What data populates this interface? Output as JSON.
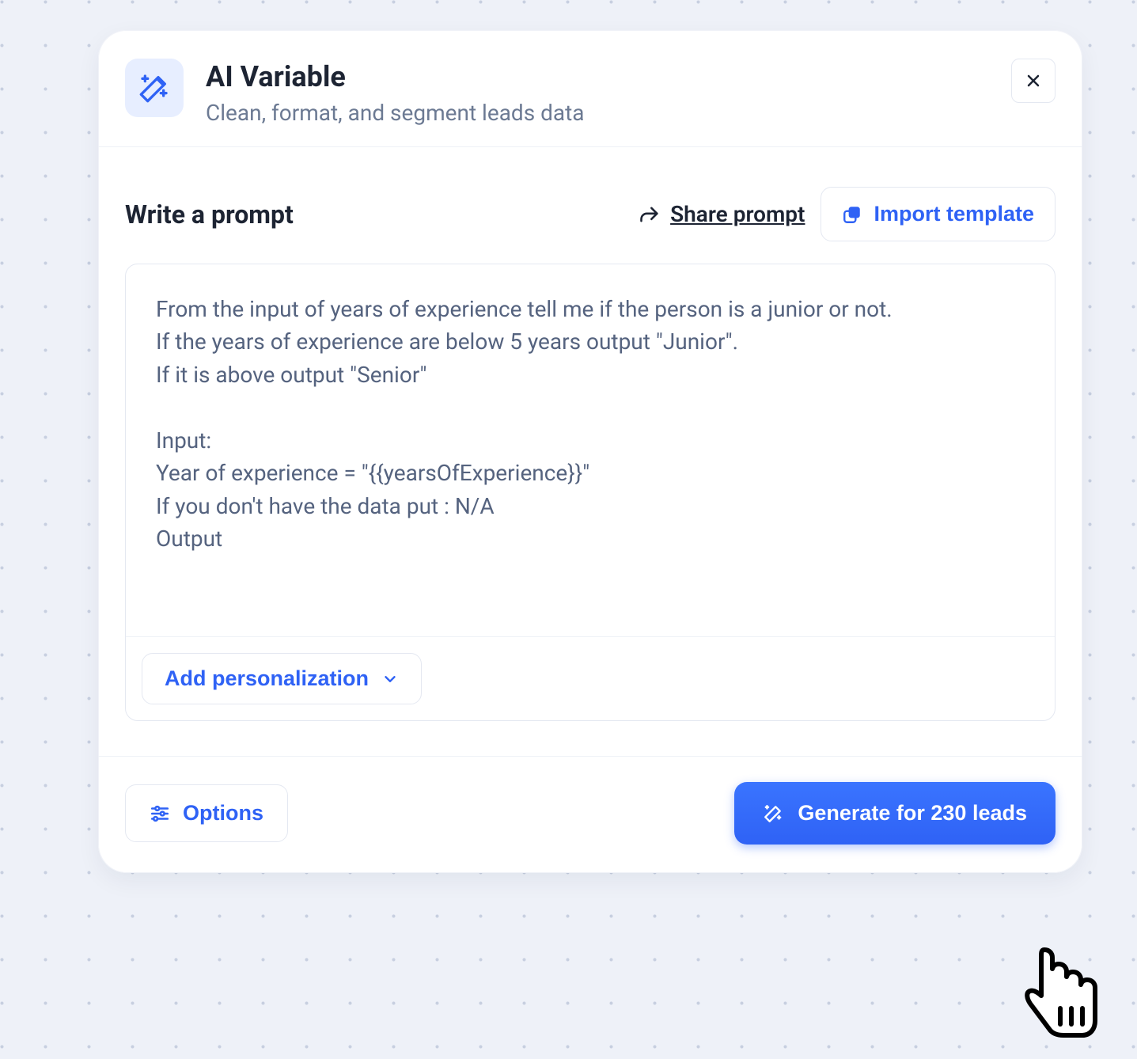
{
  "header": {
    "title": "AI Variable",
    "subtitle": "Clean, format, and segment leads data"
  },
  "prompt_section": {
    "title": "Write a prompt",
    "share_label": "Share prompt",
    "import_label": "Import template",
    "prompt_text": "From the input of years of experience tell me if the person is a junior or not.\nIf the years of experience are below 5 years output \"Junior\".\nIf it is above output \"Senior\"\n\nInput:\nYear of experience = \"{{yearsOfExperience}}\"\nIf you don't have the data put : N/A\nOutput",
    "add_personalization_label": "Add personalization"
  },
  "footer": {
    "options_label": "Options",
    "generate_label": "Generate for 230 leads"
  },
  "colors": {
    "primary": "#2f62f5",
    "icon_box_bg": "#e7eeff",
    "text_dark": "#1d2433",
    "text_muted": "#6c7a93",
    "border": "#e4e8f1"
  }
}
